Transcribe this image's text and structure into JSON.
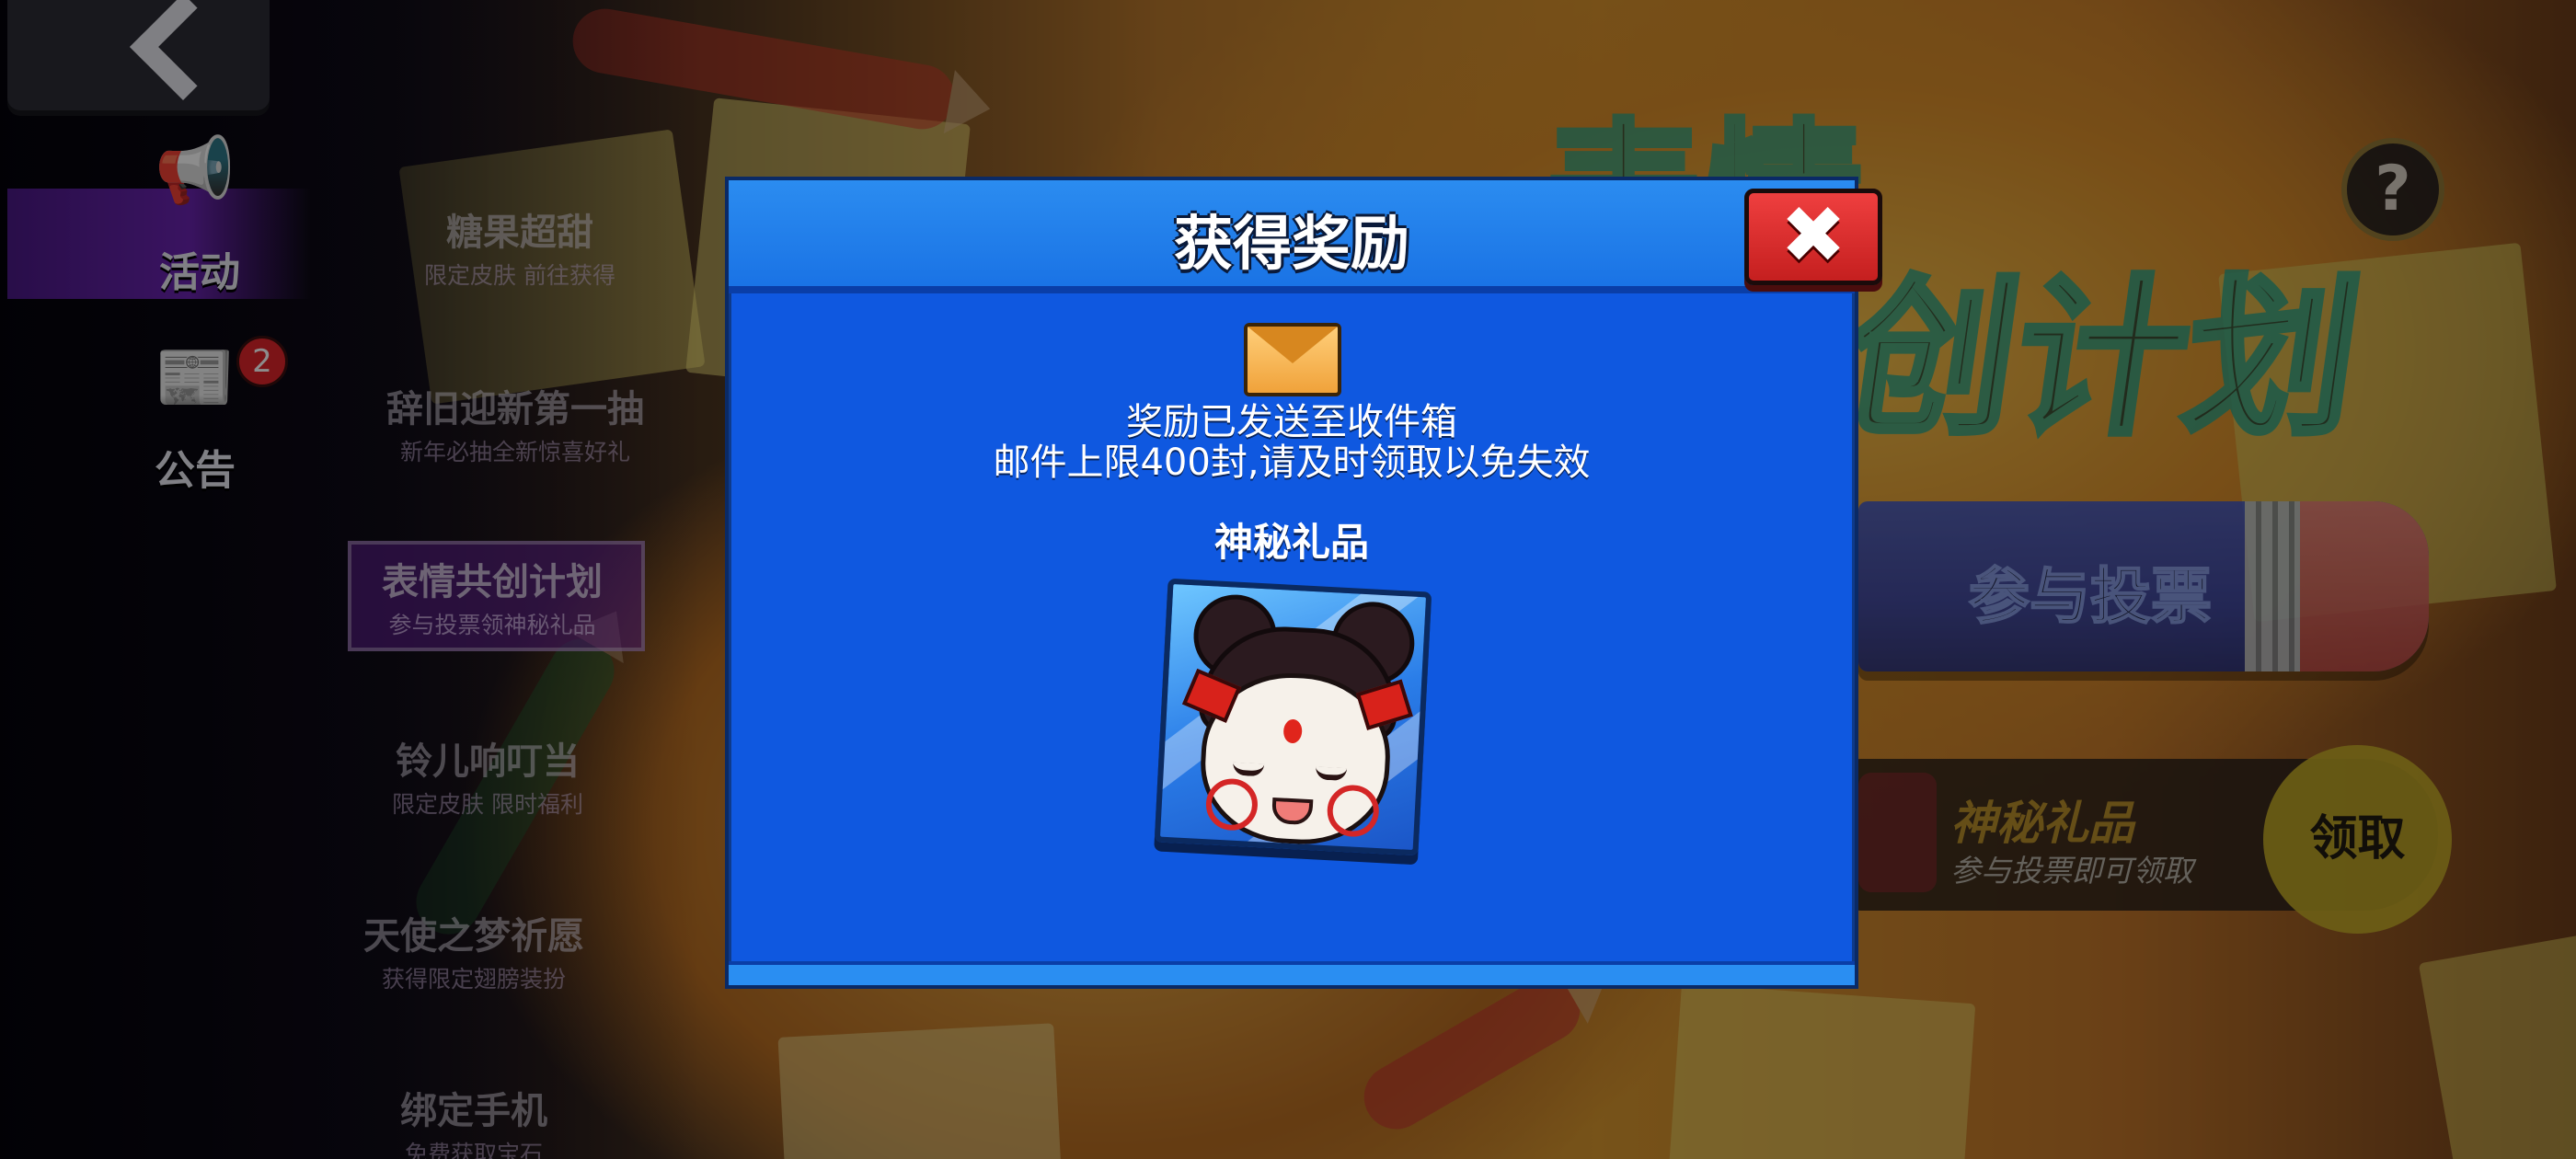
{
  "app": {
    "back_icon": "chevron-left-icon"
  },
  "sidebar": {
    "items": [
      {
        "label": "活动",
        "icon": "megaphone-icon",
        "active": true
      },
      {
        "label": "公告",
        "icon": "notice-icon",
        "badge": "2"
      }
    ]
  },
  "events": [
    {
      "title": "糖果超甜",
      "subtitle": "限定皮肤 前往获得"
    },
    {
      "title": "辞旧迎新第一抽",
      "subtitle": "新年必抽全新惊喜好礼"
    },
    {
      "title": "表情共创计划",
      "subtitle": "参与投票领神秘礼品",
      "selected": true
    },
    {
      "title": "铃儿响叮当",
      "subtitle": "限定皮肤 限时福利"
    },
    {
      "title": "天使之梦祈愿",
      "subtitle": "获得限定翅膀装扮"
    },
    {
      "title": "绑定手机",
      "subtitle": "免费获取宝石"
    }
  ],
  "background": {
    "banner_title_line1": "表情",
    "banner_title_line2": "创计划",
    "help_label": "?",
    "vote_button_label": "参与投票",
    "gift_title": "神秘礼品",
    "gift_subtitle": "参与投票即可领取",
    "claim_button_label": "领取"
  },
  "modal": {
    "title": "获得奖励",
    "close_label": "✖",
    "envelope_icon": "envelope-icon",
    "message_line1": "奖励已发送至收件箱",
    "message_line2": "邮件上限400封,请及时领取以免失效",
    "reward_name": "神秘礼品",
    "reward_icon": "panda-girl-emote-icon"
  },
  "colors": {
    "modal_bg": "#0f58e0",
    "modal_header": "#1a73e5",
    "close_button": "#d62a2a",
    "claim_button": "#c7ad28",
    "sidebar_active": "#6a24b0"
  }
}
